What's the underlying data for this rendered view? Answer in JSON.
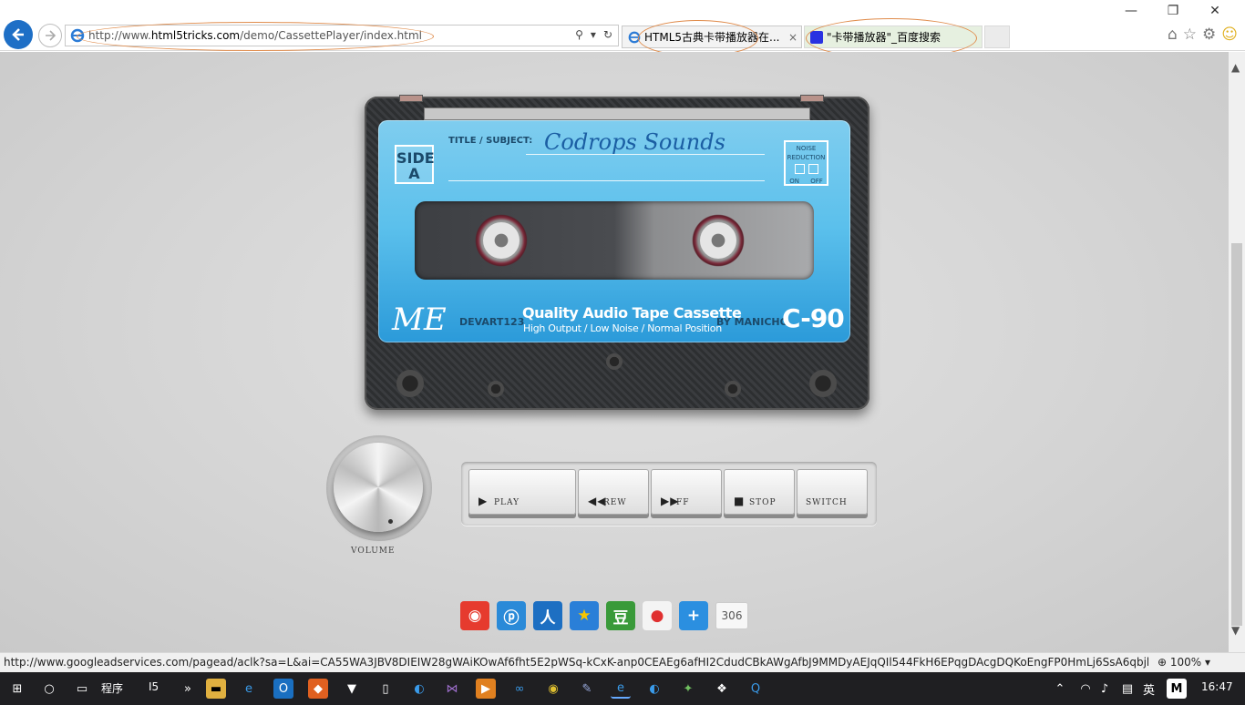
{
  "browser": {
    "url_prefix": "http://www.",
    "url_domain": "html5tricks.com",
    "url_path": "/demo/CassettePlayer/index.html",
    "tabs": [
      {
        "label": "HTML5古典卡带播放器在...",
        "close": "×"
      },
      {
        "label": "\"卡带播放器\"_百度搜索"
      }
    ],
    "window_controls": {
      "minimize": "—",
      "restore": "❐",
      "close": "✕"
    }
  },
  "cassette": {
    "side_label": "SIDE",
    "side_value": "A",
    "title_label": "TITLE / SUBJECT:",
    "title_value": "Codrops Sounds",
    "noise_reduction": "NOISE REDUCTION",
    "noise_on": "ON",
    "noise_off": "OFF",
    "brand": "ME",
    "devart": "DEVART123",
    "quality": "Quality Audio Tape Cassette",
    "quality_sub": "High Output / Low Noise / Normal Position",
    "by": "BY MANICHO",
    "model": "C-90"
  },
  "controls": {
    "volume_label": "VOLUME",
    "buttons": [
      {
        "label": "PLAY",
        "icon": "▶"
      },
      {
        "label": "REW",
        "icon": "◀◀"
      },
      {
        "label": "FF",
        "icon": "▶▶"
      },
      {
        "label": "STOP",
        "icon": "■"
      },
      {
        "label": "SWITCH",
        "icon": ""
      }
    ]
  },
  "share": {
    "count": "306"
  },
  "status": {
    "text": "http://www.googleadservices.com/pagead/aclk?sa=L&ai=CA55WA3JBV8DIEIW28gWAiKOwAf6fht5E2pWSq-kCxK-anp0CEAEg6afHI2CdudCBkAWgAfbJ9MMDyAEJqQIl544FkH6EPqgDAcgDQKoEngFP0HmLj6SsA6qbjlU-p",
    "zoom": "100%"
  },
  "taskbar": {
    "programs_label": "程序",
    "i5_label": "I5",
    "ime": "英",
    "clock": "16:47"
  },
  "colors": {
    "accent": "#1e6fc6",
    "label_blue": "#5bc0ec",
    "annotation": "#e08c4c"
  }
}
